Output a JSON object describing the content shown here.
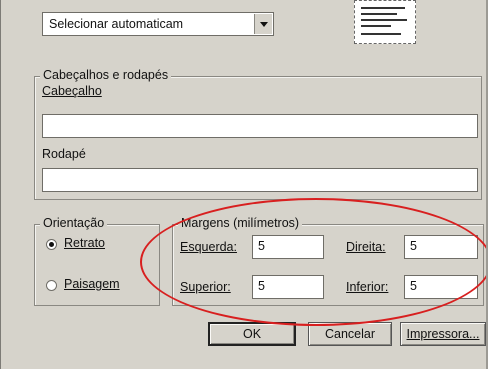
{
  "paper_select": {
    "value": "Selecionar automaticam"
  },
  "headers_footers": {
    "title": "Cabeçalhos e rodapés",
    "header_label": "Cabeçalho",
    "header_value": "",
    "footer_label": "Rodapé",
    "footer_value": ""
  },
  "orientation": {
    "title": "Orientação",
    "options": [
      {
        "label": "Retrato",
        "selected": true
      },
      {
        "label": "Paisagem",
        "selected": false
      }
    ]
  },
  "margins": {
    "title": "Margens (milímetros)",
    "left_label": "Esquerda:",
    "left_value": "5",
    "right_label": "Direita:",
    "right_value": "5",
    "top_label": "Superior:",
    "top_value": "5",
    "bottom_label": "Inferior:",
    "bottom_value": "5"
  },
  "buttons": {
    "ok": "OK",
    "cancel": "Cancelar",
    "printer": "Impressora..."
  },
  "annotation": {
    "color": "#d81f1f",
    "shape": "ellipse"
  }
}
